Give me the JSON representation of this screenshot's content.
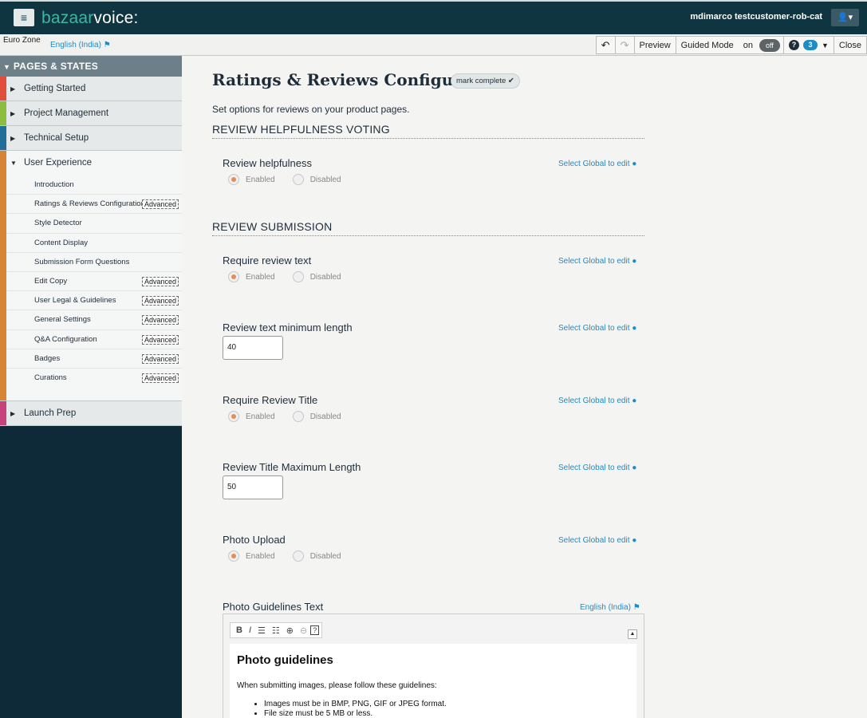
{
  "app": {
    "menu_icon": "hamburger-icon",
    "logo_left": "bazaar",
    "logo_right": "voice:",
    "user": "mdimarco  testcustomer-rob-cat",
    "user_icon": "user-icon"
  },
  "subbar": {
    "zone": "Euro Zone",
    "locale": "English (India)",
    "undo_icon": "undo-icon",
    "redo_icon": "redo-icon",
    "preview": "Preview",
    "guided_mode": "Guided Mode",
    "guided_on": "on",
    "guided_off": "off",
    "help_icon": "help-icon",
    "notification_count": "3",
    "close": "Close"
  },
  "sidebar": {
    "header": "PAGES & STATES",
    "sections_top": [
      {
        "label": "Getting Started",
        "color": "#e04e3c"
      },
      {
        "label": "Project Management",
        "color": "#8cbd3e"
      },
      {
        "label": "Technical Setup",
        "color": "#1f6f99"
      }
    ],
    "open_section": {
      "label": "User Experience",
      "color": "#d68536",
      "items": [
        {
          "label": "Introduction",
          "badge": ""
        },
        {
          "label": "Ratings & Reviews Configuration",
          "badge": "Advanced"
        },
        {
          "label": "Style Detector",
          "badge": ""
        },
        {
          "label": "Content Display",
          "badge": ""
        },
        {
          "label": "Submission Form Questions",
          "badge": ""
        },
        {
          "label": "Edit Copy",
          "badge": "Advanced"
        },
        {
          "label": "User Legal & Guidelines",
          "badge": "Advanced"
        },
        {
          "label": "General Settings",
          "badge": "Advanced"
        },
        {
          "label": "Q&A Configuration",
          "badge": "Advanced"
        },
        {
          "label": "Badges",
          "badge": "Advanced"
        },
        {
          "label": "Curations",
          "badge": "Advanced"
        }
      ]
    },
    "sections_bottom": [
      {
        "label": "Launch Prep",
        "color": "#c7427a"
      }
    ]
  },
  "main": {
    "title": "Ratings & Reviews Configuration",
    "mark_complete": "mark complete ✔",
    "intro": "Set options for reviews on your product pages.",
    "sections": {
      "voting": "REVIEW HELPFULNESS VOTING",
      "submission": "REVIEW SUBMISSION"
    },
    "enabled_label": "Enabled",
    "disabled_label": "Disabled",
    "global_note": "Select Global to edit",
    "fields": {
      "review_helpfulness": "Review helpfulness",
      "require_review_text": "Require review text",
      "review_text_min_length": "Review text minimum length",
      "review_text_min_value": "40",
      "require_review_title": "Require Review Title",
      "review_title_max_length": "Review Title Maximum Length",
      "review_title_max_value": "50",
      "photo_upload": "Photo Upload",
      "photo_guidelines_text": "Photo Guidelines Text",
      "photo_guidelines_locale": "English (India)"
    },
    "editor": {
      "tools": [
        "B",
        "I",
        "numbered-list-icon",
        "bulleted-list-icon",
        "link-icon",
        "unlink-icon",
        "?"
      ],
      "heading": "Photo guidelines",
      "paragraph": "When submitting images, please follow these guidelines:",
      "bullets": [
        "Images must be in BMP, PNG, GIF or JPEG format.",
        "File size must be 5 MB or less."
      ]
    }
  }
}
